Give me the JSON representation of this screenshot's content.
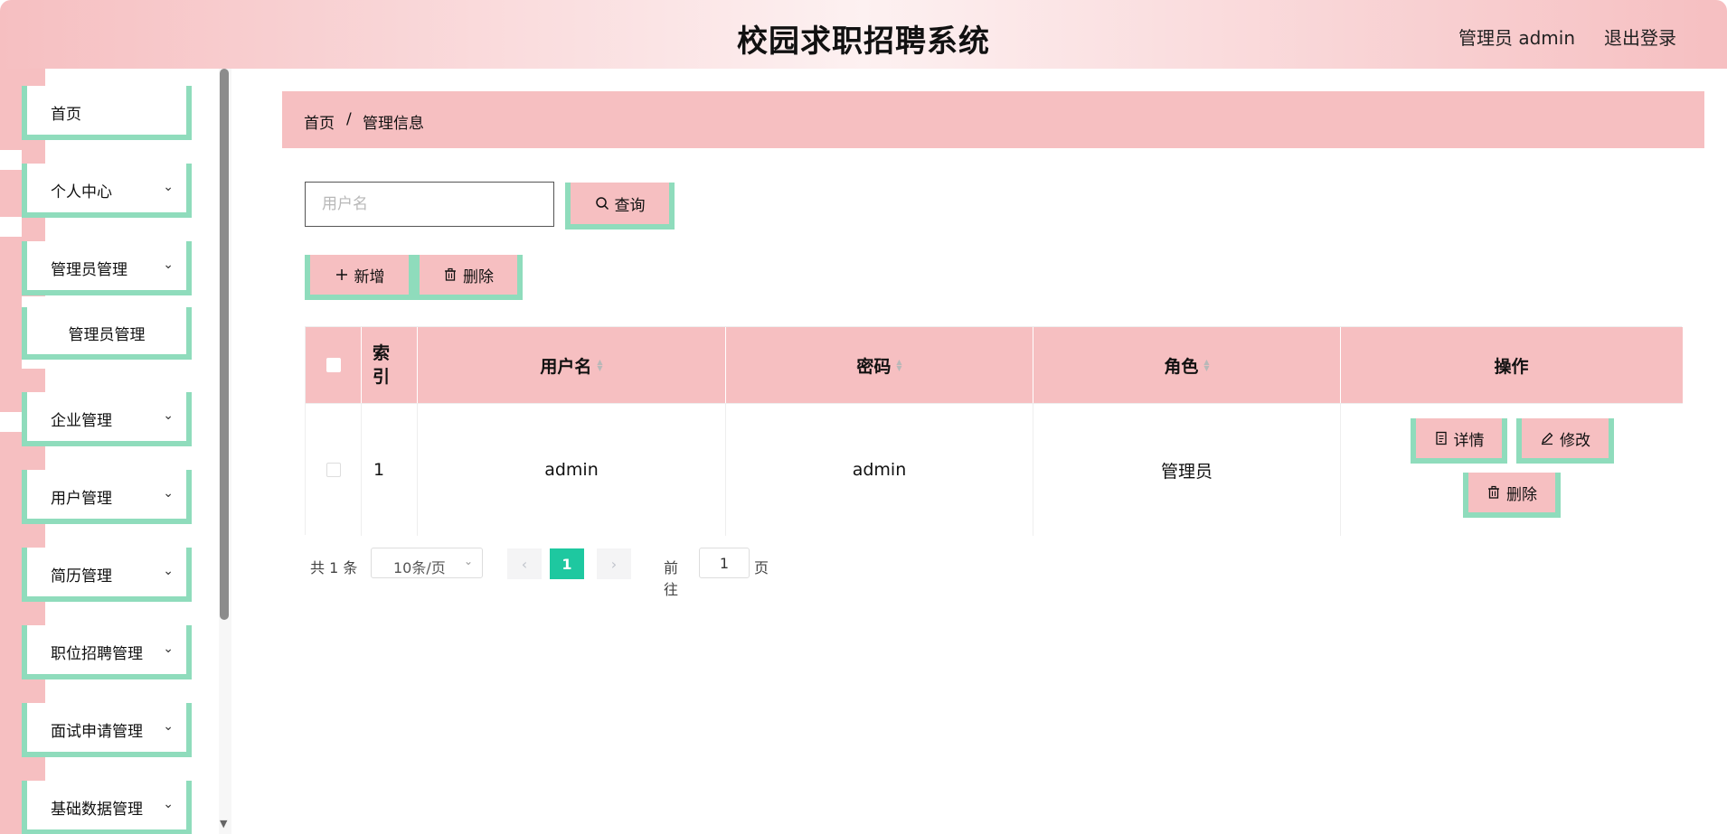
{
  "header": {
    "title": "校园求职招聘系统",
    "user": "管理员 admin",
    "logout": "退出登录"
  },
  "sidebar": {
    "items": [
      {
        "label": "首页"
      },
      {
        "label": "个人中心"
      },
      {
        "label": "管理员管理"
      },
      {
        "label": "企业管理"
      },
      {
        "label": "用户管理"
      },
      {
        "label": "简历管理"
      },
      {
        "label": "职位招聘管理"
      },
      {
        "label": "面试申请管理"
      },
      {
        "label": "基础数据管理"
      }
    ],
    "submenu": {
      "label": "管理员管理"
    }
  },
  "breadcrumb": {
    "home": "首页",
    "separator": "/",
    "current": "管理信息"
  },
  "search": {
    "placeholder": "用户名",
    "value": "",
    "button": "查询"
  },
  "actions": {
    "add": "新增",
    "delete": "删除"
  },
  "table": {
    "columns": [
      "索引",
      "用户名",
      "密码",
      "角色",
      "操作"
    ],
    "rows": [
      {
        "index": "1",
        "username": "admin",
        "password": "admin",
        "role": "管理员",
        "ops": {
          "detail": "详情",
          "edit": "修改",
          "delete": "删除"
        }
      }
    ]
  },
  "pagination": {
    "total": "共 1 条",
    "page_size": "10条/页",
    "current": "1",
    "goto_prefix": "前往",
    "goto_value": "1",
    "goto_suffix": "页"
  },
  "colors": {
    "pink": "#f6bfc1",
    "green_border": "#8fdcbc",
    "active_page": "#1ec8a0"
  }
}
